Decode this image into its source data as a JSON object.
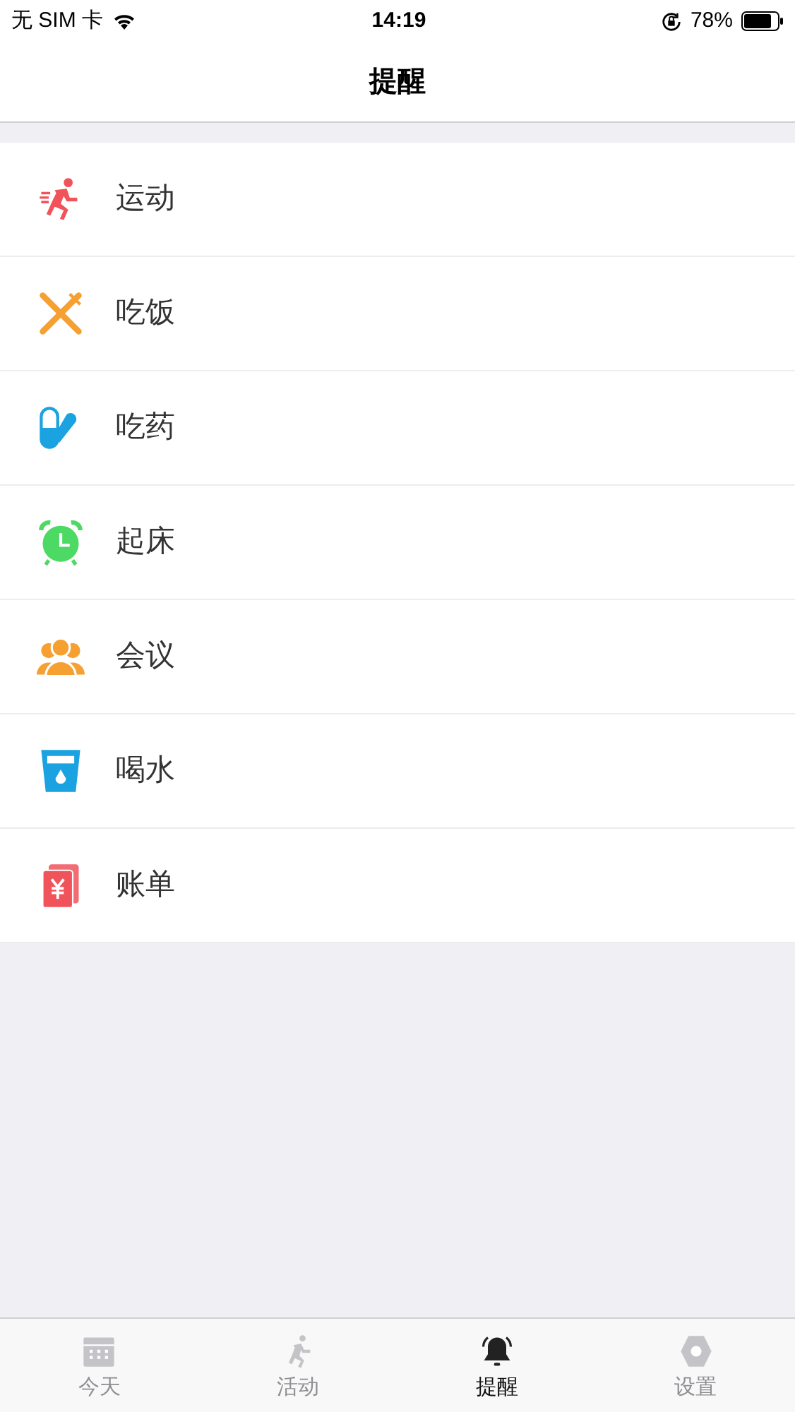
{
  "status_bar": {
    "carrier": "无 SIM 卡",
    "time": "14:19",
    "battery": "78%"
  },
  "nav": {
    "title": "提醒"
  },
  "reminders": [
    {
      "label": "运动",
      "kind": "run",
      "color": "#f0545a"
    },
    {
      "label": "吃饭",
      "kind": "cutlery",
      "color": "#f5a030"
    },
    {
      "label": "吃药",
      "kind": "pill",
      "color": "#1aa3e0"
    },
    {
      "label": "起床",
      "kind": "alarm",
      "color": "#4cd964"
    },
    {
      "label": "会议",
      "kind": "people",
      "color": "#f5a030"
    },
    {
      "label": "喝水",
      "kind": "cup",
      "color": "#1aa3e0"
    },
    {
      "label": "账单",
      "kind": "bill",
      "color": "#f0545a"
    }
  ],
  "tabs": [
    {
      "label": "今天",
      "kind": "calendar",
      "selected": false
    },
    {
      "label": "活动",
      "kind": "run",
      "selected": false
    },
    {
      "label": "提醒",
      "kind": "bell",
      "selected": true
    },
    {
      "label": "设置",
      "kind": "gear",
      "selected": false
    }
  ]
}
